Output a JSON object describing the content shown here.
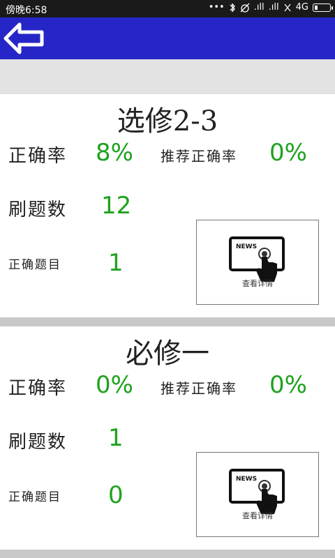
{
  "status_bar": {
    "time": "傍晚6:58",
    "icons": [
      "more-dots-icon",
      "bluetooth-icon",
      "alarm-off-icon",
      "signal-icon",
      "signal-icon",
      "sound-off-icon",
      "network-icon",
      "battery-icon"
    ],
    "signal1": ".ıll",
    "signal2": ".ıll",
    "network": "4G",
    "dots": "•••"
  },
  "app_bar": {
    "back_icon": "back-arrow-icon",
    "color": "#2626c8"
  },
  "cards": [
    {
      "title": "选修2-3",
      "accuracy_label": "正确率",
      "accuracy_value": "8%",
      "recommended_label": "推荐正确率",
      "recommended_value": "0%",
      "questions_label": "刷题数",
      "questions_value": "12",
      "correct_label": "正确题目",
      "correct_value": "1",
      "news_badge": "NEWS",
      "news_label": "查看详情"
    },
    {
      "title": "必修一",
      "accuracy_label": "正确率",
      "accuracy_value": "0%",
      "recommended_label": "推荐正确率",
      "recommended_value": "0%",
      "questions_label": "刷题数",
      "questions_value": "1",
      "correct_label": "正确题目",
      "correct_value": "0",
      "news_badge": "NEWS",
      "news_label": "查看详情"
    }
  ],
  "colors": {
    "value_green": "#1ea21e",
    "app_bar_blue": "#2626c8",
    "divider_gray": "#c8c8c8"
  }
}
